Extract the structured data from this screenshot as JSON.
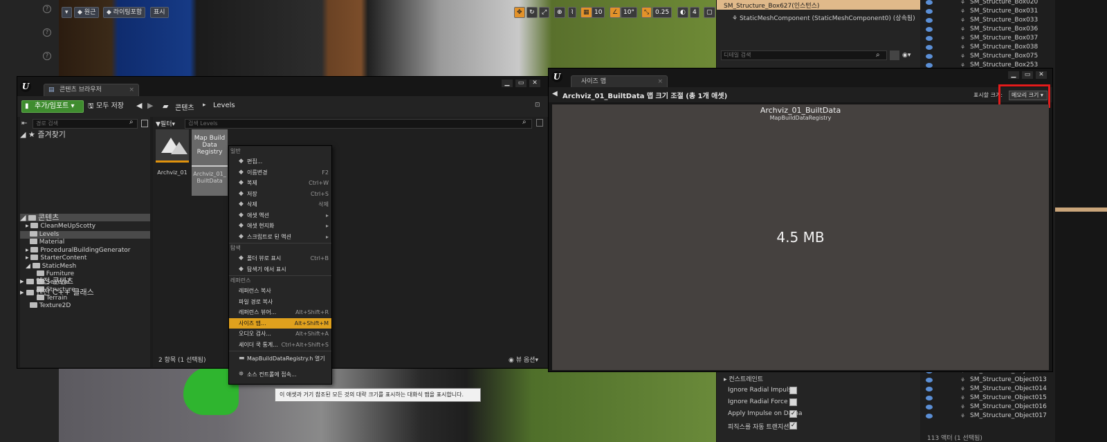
{
  "viewport": {
    "perspective_label": "원근",
    "lighting_label": "라이팅포함",
    "show_label": "표시",
    "grid_snap_value": "10",
    "rotate_snap_value": "10°",
    "scale_snap_value": "0.25",
    "camera_speed_value": "4"
  },
  "details": {
    "selected_instance": "SM_Structure_Box627(인스턴스)",
    "component": "StaticMeshComponent (StaticMeshComponent0) (상속됨)",
    "search_placeholder": "디테일 검색",
    "section_constraints": "컨스트레인트",
    "props": [
      {
        "label": "Ignore Radial Impulse",
        "checked": false
      },
      {
        "label": "Ignore Radial Force",
        "checked": false
      },
      {
        "label": "Apply Impulse on Dama",
        "checked": true
      },
      {
        "label": "피직스를 자동 트랜지션 로",
        "checked": true
      }
    ]
  },
  "outliner": {
    "top_items": [
      "SM_Structure_Box020",
      "SM_Structure_Box031",
      "SM_Structure_Box033",
      "SM_Structure_Box036",
      "SM_Structure_Box037",
      "SM_Structure_Box038",
      "SM_Structure_Box075",
      "SM_Structure_Box253"
    ],
    "bottom_items": [
      "SM_Structure_Object012",
      "SM_Structure_Object013",
      "SM_Structure_Object014",
      "SM_Structure_Object015",
      "SM_Structure_Object016",
      "SM_Structure_Object017"
    ],
    "footer": "113 액터 (1 선택됨)"
  },
  "content_browser": {
    "tab_title": "콘텐츠 브라우저",
    "add_import_label": "추가/임포트",
    "save_all_label": "모두 저장",
    "breadcrumb_root": "콘텐츠",
    "breadcrumb_current": "Levels",
    "path_search_placeholder": "경로 검색",
    "filter_label": "필터",
    "search_placeholder": "검색 Levels",
    "favorites_label": "즐겨찾기",
    "tree": [
      {
        "label": "콘텐츠",
        "level": 0,
        "selected": true
      },
      {
        "label": "CleanMeUpScotty",
        "level": 1,
        "selected": false
      },
      {
        "label": "Levels",
        "level": 1,
        "selected": true
      },
      {
        "label": "Material",
        "level": 1,
        "selected": false
      },
      {
        "label": "ProceduralBuildingGenerator",
        "level": 1,
        "selected": false
      },
      {
        "label": "StarterContent",
        "level": 1,
        "selected": false
      },
      {
        "label": "StaticMesh",
        "level": 1,
        "selected": false
      },
      {
        "label": "Furniture",
        "level": 2,
        "selected": false
      },
      {
        "label": "Several",
        "level": 2,
        "selected": false
      },
      {
        "label": "Structure",
        "level": 2,
        "selected": false
      },
      {
        "label": "Terrain",
        "level": 2,
        "selected": false
      },
      {
        "label": "Texture2D",
        "level": 1,
        "selected": false
      }
    ],
    "engine_content_label": "엔진 콘텐츠",
    "engine_cpp_label": "엔진 C++ 클래스",
    "assets": [
      {
        "name": "Archviz_01",
        "thumb_text": ""
      },
      {
        "name": "Archviz_01_ BuiltData",
        "thumb_text": "Map Build Data Registry"
      }
    ],
    "item_count": "2 항목 (1 선택됨)",
    "view_options_label": "뷰 옵션"
  },
  "context_menu": {
    "sections": [
      {
        "header": "일반",
        "items": [
          {
            "label": "편집...",
            "shortcut": "",
            "icon": "edit-icon",
            "sub": false
          },
          {
            "label": "이름변경",
            "shortcut": "F2",
            "icon": "rename-icon",
            "sub": false
          },
          {
            "label": "복제",
            "shortcut": "Ctrl+W",
            "icon": "duplicate-icon",
            "sub": false
          },
          {
            "label": "저장",
            "shortcut": "Ctrl+S",
            "icon": "save-icon",
            "sub": false
          },
          {
            "label": "삭제",
            "shortcut": "삭제",
            "icon": "delete-icon",
            "sub": false
          },
          {
            "label": "애셋 액션",
            "shortcut": "",
            "icon": "wrench-icon",
            "sub": true
          },
          {
            "label": "애셋 현지화",
            "shortcut": "",
            "icon": "globe-icon",
            "sub": true
          },
          {
            "label": "스크립트로 된 액션",
            "shortcut": "",
            "icon": "script-icon",
            "sub": true
          }
        ]
      },
      {
        "header": "탐색",
        "items": [
          {
            "label": "폴더 뷰로 표시",
            "shortcut": "Ctrl+B",
            "icon": "find-icon",
            "sub": false
          },
          {
            "label": "탐색기 에서 표시",
            "shortcut": "",
            "icon": "explorer-icon",
            "sub": false
          }
        ]
      },
      {
        "header": "레퍼런스",
        "items": [
          {
            "label": "레퍼런스 복사",
            "shortcut": "",
            "icon": "",
            "sub": false
          },
          {
            "label": "파일 경로 복사",
            "shortcut": "",
            "icon": "",
            "sub": false
          },
          {
            "label": "레퍼런스 뷰어...",
            "shortcut": "Alt+Shift+R",
            "icon": "",
            "sub": false
          },
          {
            "label": "사이즈 맵...",
            "shortcut": "Alt+Shift+M",
            "icon": "",
            "sub": false,
            "highlight": true
          },
          {
            "label": "오디오 검사...",
            "shortcut": "Alt+Shift+A",
            "icon": "",
            "sub": false
          },
          {
            "label": "셰이더 쿡 통계...",
            "shortcut": "Ctrl+Alt+Shift+S",
            "icon": "",
            "sub": false
          }
        ]
      }
    ],
    "open_header_label": "MapBuildDataRegistry.h 열기",
    "source_control_label": "소스 컨트롤에 접속..."
  },
  "tooltip": "이 애셋과 거기 참조된 모든 것의 대략 크기를 표시하는 대화식 맵을 표시합니다.",
  "size_map": {
    "tab_title": "사이즈 맵",
    "header": "Archviz_01_BuiltData 맵 크기 조절 (총 1개 애셋)",
    "display_size_label": "표시할 크기:",
    "display_size_value": "메모리 크기",
    "asset_name": "Archviz_01_BuiltData",
    "asset_type": "MapBuildDataRegistry",
    "size": "4.5 MB"
  },
  "colors": {
    "highlight": "#e0a11d",
    "annotation_red": "#e41b1b",
    "add_import_green": "#3f8c2f"
  }
}
